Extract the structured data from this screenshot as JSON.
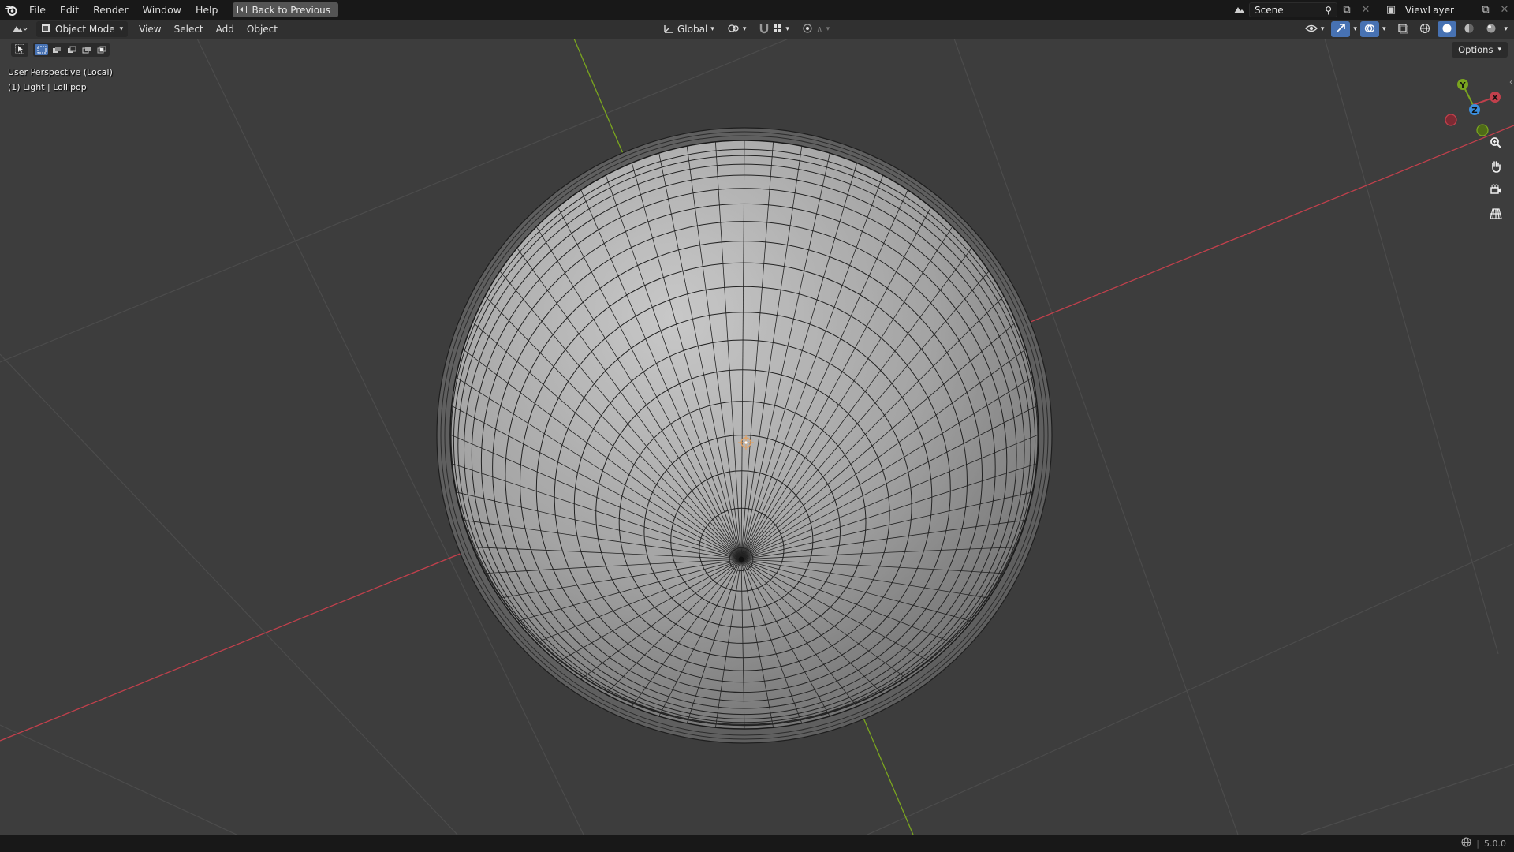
{
  "topbar": {
    "menus": [
      "File",
      "Edit",
      "Render",
      "Window",
      "Help"
    ],
    "back_label": "Back to Previous",
    "scene_name": "Scene",
    "viewlayer_name": "ViewLayer"
  },
  "header": {
    "mode": "Object Mode",
    "menus": [
      "View",
      "Select",
      "Add",
      "Object"
    ],
    "orientation": "Global",
    "options_label": "Options"
  },
  "viewport": {
    "perspective_label": "User Perspective (Local)",
    "object_label": "(1) Light | Lollipop",
    "gizmo_axes": {
      "x": "X",
      "y": "Y",
      "z": "Z"
    },
    "colors": {
      "x_axis": "#c1404c",
      "y_axis": "#7aa51f",
      "z_axis": "#3b8fde",
      "background": "#3d3d3d",
      "grid": "#4a4a4a"
    }
  },
  "statusbar": {
    "version": "5.0.0"
  }
}
